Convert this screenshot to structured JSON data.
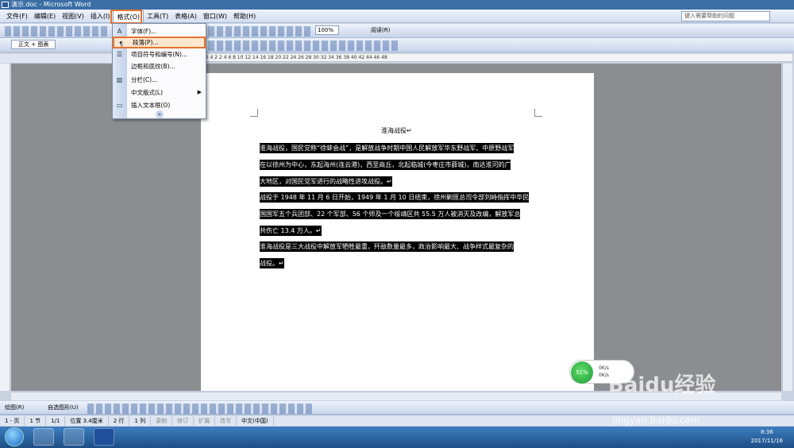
{
  "window": {
    "title": "演示.doc - Microsoft Word"
  },
  "menubar": {
    "items": [
      {
        "label": "文件(F)"
      },
      {
        "label": "编辑(E)"
      },
      {
        "label": "视图(V)"
      },
      {
        "label": "插入(I)"
      },
      {
        "label": "格式(O)"
      },
      {
        "label": "工具(T)"
      },
      {
        "label": "表格(A)"
      },
      {
        "label": "窗口(W)"
      },
      {
        "label": "帮助(H)"
      }
    ],
    "active": "格式(O)",
    "ask_placeholder": "键入需要帮助的问题"
  },
  "toolbar": {
    "zoom": "100%",
    "read_label": "阅读(R)",
    "style_value": "正文 + 图表"
  },
  "format_menu": {
    "items": [
      {
        "label": "字体(F)...",
        "icon": "A"
      },
      {
        "label": "段落(P)...",
        "icon": "¶"
      },
      {
        "label": "项目符号和编号(N)...",
        "icon": "☰"
      },
      {
        "label": "边框和底纹(B)...",
        "icon": ""
      },
      {
        "label": "分栏(C)...",
        "icon": "▥"
      },
      {
        "label": "中文版式(L)",
        "icon": ""
      },
      {
        "label": "插入文本框(O)",
        "icon": "▭"
      }
    ],
    "highlighted": "段落(P)..."
  },
  "ruler": {
    "marks": "8  6  4  2     2  4  6  8  10  12  14  16  18  20  22  24  26  28  30  32  34  36  38  40  42  44  46  48"
  },
  "document": {
    "title": "淮海战役↵",
    "paragraphs": [
      [
        "淮海战役，国民党称“徐蚌会战”，是解放战争时期中国人民解放军华东野战军、中原野战军",
        "在以徐州为中心，东起海州(连云港)，西至商丘，北起临城(今枣庄市薛城)，南达淮河的广",
        "大地区，对国民党军进行的战略性进攻战役。↵"
      ],
      [
        "战役于 1948 年 11 月 6 日开始，1949 年 1 月 10 日结束，徐州剿匪总司令部刘峙指挥中华民",
        "国国军五个兵团部、22 个军部、56 个师及一个绥靖区共 55.5 万人被消灭及改编，解放军总",
        "共伤亡 13.4 万人。↵"
      ],
      [
        "淮海战役是三大战役中解放军牺牲最重，歼敌数量最多，政治影响最大、战争样式最复杂的",
        "战役。↵"
      ]
    ]
  },
  "statusbar": {
    "page": "1 - 页",
    "section": "1 节",
    "pages": "1/1",
    "position": "位置 3.4厘米",
    "line": "2 行",
    "column": "1 列",
    "rec": "录制",
    "trk": "修订",
    "ext": "扩展",
    "ovr": "改写",
    "language": "中文(中国)"
  },
  "drawbar": {
    "draw_label": "绘图(R)",
    "autoshape_label": "自选图形(U)"
  },
  "network_widget": {
    "percent": "51%",
    "up": "0K/s",
    "down": "0K/s"
  },
  "taskbar": {
    "time": "8:36",
    "date": "2017/11/16"
  },
  "watermark": {
    "brand": "Baidu经验",
    "url": "jingyan.baidu.com"
  }
}
